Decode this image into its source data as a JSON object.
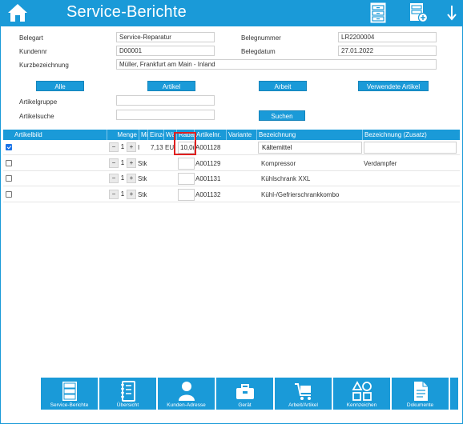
{
  "header": {
    "title": "Service-Berichte"
  },
  "form": {
    "belegart_label": "Belegart",
    "belegart_value": "Service-Reparatur",
    "belegnummer_label": "Belegnummer",
    "belegnummer_value": "LR2200004",
    "kundennr_label": "Kundennr",
    "kundennr_value": "D00001",
    "belegdatum_label": "Belegdatum",
    "belegdatum_value": "27.01.2022",
    "kurzbezeichnung_label": "Kurzbezeichnung",
    "kurzbezeichnung_value": "Müller, Frankfurt am Main - Inland"
  },
  "filter_buttons": {
    "alle": "Alle",
    "artikel": "Artikel",
    "arbeit": "Arbeit",
    "verwendete": "Verwendete Artikel"
  },
  "search": {
    "artikelgruppe_label": "Artikelgruppe",
    "artikelsuche_label": "Artikelsuche",
    "suchen": "Suchen"
  },
  "table": {
    "headers": [
      "Artikelbild",
      "Menge",
      "Mi",
      "Einze",
      "Wä",
      "Raba",
      "Artikelnr.",
      "Variante",
      "Bezeichnung",
      "Bezeichnung (Zusatz)"
    ],
    "rows": [
      {
        "checked": true,
        "menge": "1",
        "einheit": "I",
        "preis": "7,13",
        "waehrung": "EU",
        "rabatt": "10,0(",
        "artikelnr": "A001128",
        "bezeichnung": "Kältemittel",
        "zusatz": ""
      },
      {
        "checked": false,
        "menge": "1",
        "einheit": "Stk",
        "preis": "",
        "waehrung": "",
        "rabatt": "",
        "artikelnr": "A001129",
        "bezeichnung": "Kompressor",
        "zusatz": "Verdampfer"
      },
      {
        "checked": false,
        "menge": "1",
        "einheit": "Stk",
        "preis": "",
        "waehrung": "",
        "rabatt": "",
        "artikelnr": "A001131",
        "bezeichnung": "Kühlschrank XXL",
        "zusatz": ""
      },
      {
        "checked": false,
        "menge": "1",
        "einheit": "Stk",
        "preis": "",
        "waehrung": "",
        "rabatt": "",
        "artikelnr": "A001132",
        "bezeichnung": "Kühl-/Gefrierschrankkombo",
        "zusatz": ""
      }
    ],
    "minus": "−",
    "plus": "+"
  },
  "toolbar": {
    "service_berichte": "Service-Berichte",
    "uebersicht": "Übersicht",
    "kunden_adresse": "Kunden-Adresse",
    "geraet": "Gerät",
    "arbeit_artikel": "Arbeit/Artikel",
    "kennzeichen": "Kennzeichen",
    "dokumente": "Dokumente"
  },
  "colors": {
    "accent": "#1a9ad8",
    "highlight": "#e02020",
    "checkbox": "#1a73e8"
  },
  "icons": [
    "home-icon",
    "list-document-icon",
    "add-document-icon",
    "arrow-down-icon",
    "cabinet-icon",
    "notebook-icon",
    "person-icon",
    "toolbox-icon",
    "cart-icon",
    "shapes-icon",
    "document-icon"
  ]
}
